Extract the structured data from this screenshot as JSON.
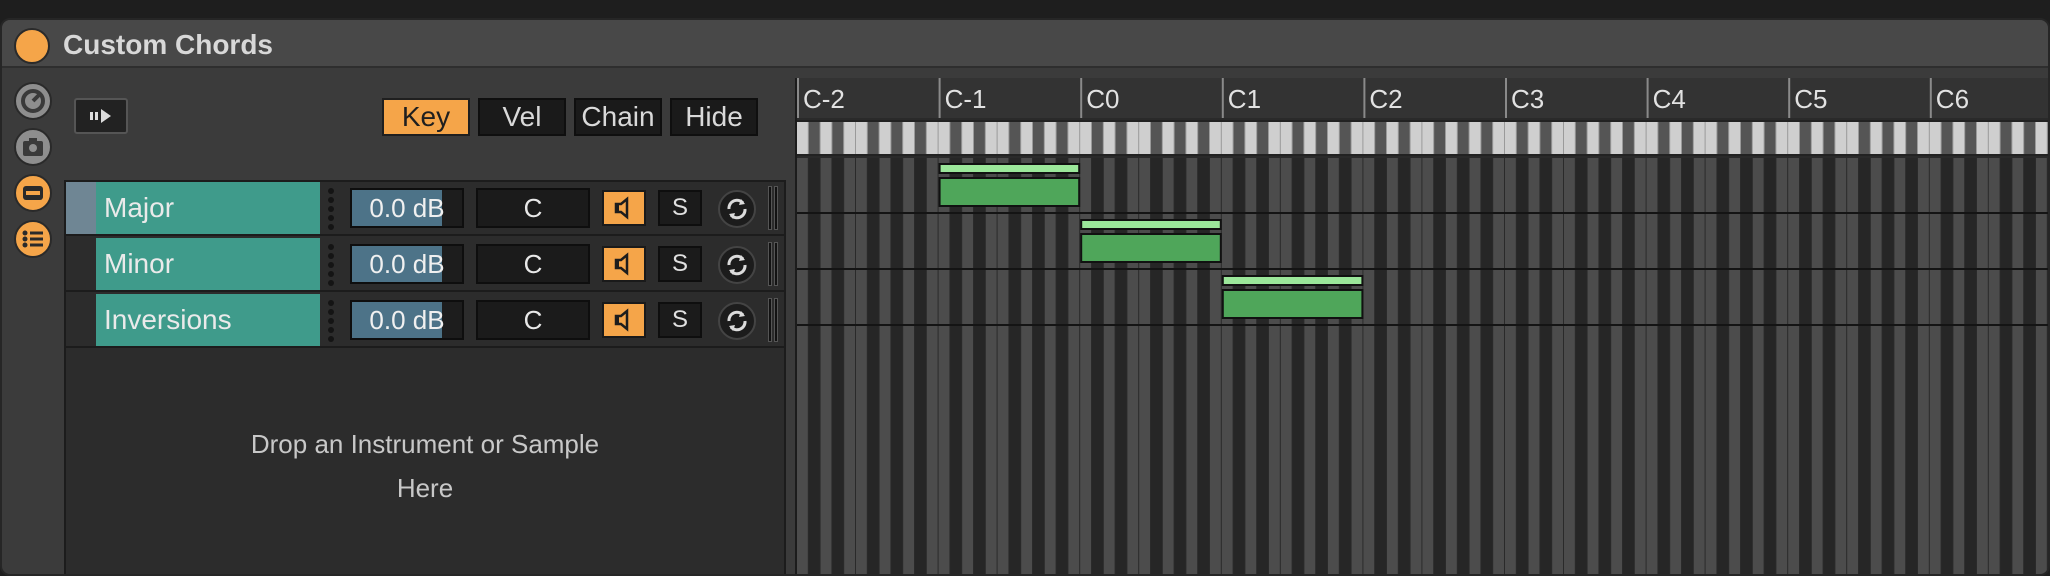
{
  "device": {
    "title": "Custom Chords",
    "accent": "#f5a549",
    "chain_color": "#3f9b8b",
    "zone_color": "#4fa65a",
    "zone_top_color": "#9be79a"
  },
  "side_icons": [
    "macro-knob-icon",
    "snapshot-icon",
    "chain-view-icon",
    "list-view-icon"
  ],
  "tabs": [
    {
      "id": "key",
      "label": "Key",
      "active": true
    },
    {
      "id": "vel",
      "label": "Vel",
      "active": false
    },
    {
      "id": "chain",
      "label": "Chain",
      "active": false
    },
    {
      "id": "hide",
      "label": "Hide",
      "active": false
    }
  ],
  "chains": [
    {
      "name": "Major",
      "volume": "0.0 dB",
      "volume_fill": 0.82,
      "key": "C",
      "solo": "S",
      "selected": true,
      "zone_start": 12,
      "zone_end": 23
    },
    {
      "name": "Minor",
      "volume": "0.0 dB",
      "volume_fill": 0.82,
      "key": "C",
      "solo": "S",
      "selected": false,
      "zone_start": 24,
      "zone_end": 35
    },
    {
      "name": "Inversions",
      "volume": "0.0 dB",
      "volume_fill": 0.82,
      "key": "C",
      "solo": "S",
      "selected": false,
      "zone_start": 36,
      "zone_end": 47
    }
  ],
  "drop_hint": {
    "line1": "Drop an Instrument or Sample",
    "line2": "Here"
  },
  "ruler": {
    "octave_labels": [
      "C-2",
      "C-1",
      "C0",
      "C1",
      "C2",
      "C3",
      "C4",
      "C5",
      "C6"
    ]
  }
}
